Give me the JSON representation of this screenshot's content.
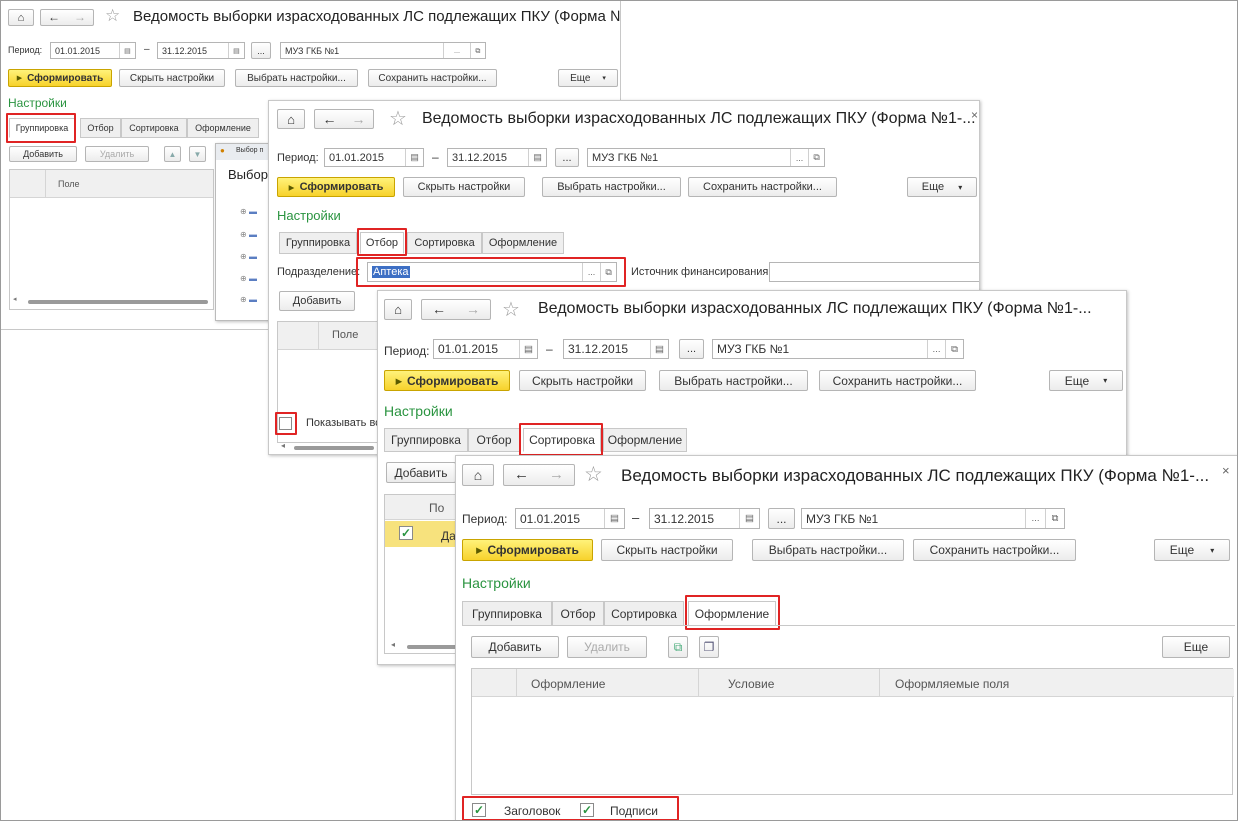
{
  "report": {
    "title": "Ведомость выборки израсходованных ЛС подлежащих ПКУ (Форма №1-...",
    "period_label": "Период:",
    "date_from": "01.01.2015",
    "date_to": "31.12.2015",
    "dash": "–",
    "dots": "...",
    "org": "МУЗ ГКБ №1",
    "generate": "Сформировать",
    "hide_settings": "Скрыть настройки",
    "choose_settings": "Выбрать настройки...",
    "save_settings": "Сохранить настройки...",
    "more": "Еще",
    "settings": "Настройки",
    "close": "×"
  },
  "tabs": {
    "grouping": "Группировка",
    "filter": "Отбор",
    "sorting": "Сортировка",
    "design": "Оформление"
  },
  "win1": {
    "add": "Добавить",
    "delete": "Удалить",
    "field_col": "Поле",
    "popup_title": "Выбор п",
    "popup_heading": "Выборк"
  },
  "win2": {
    "subdivision_label": "Подразделение:",
    "subdivision_value": "Аптека",
    "source_label": "Источник финансирования:",
    "add": "Добавить",
    "field_col": "Поле",
    "show_all": "Показывать вс"
  },
  "win3": {
    "add": "Добавить",
    "col_short": "По",
    "row_short": "Да"
  },
  "win4": {
    "add": "Добавить",
    "delete": "Удалить",
    "more": "Еще",
    "col_design": "Оформление",
    "col_condition": "Условие",
    "col_fields": "Оформляемые поля",
    "header_chk": "Заголовок",
    "signatures_chk": "Подписи"
  },
  "icons": {
    "home": "home-icon",
    "back": "arrow-left-icon",
    "forward": "arrow-right-icon",
    "favorite": "star-icon",
    "calendar": "calendar-icon",
    "open": "open-link-icon",
    "dropdown": "chevron-down-icon"
  },
  "colors": {
    "accent_green": "#2a9440",
    "highlight_red": "#e02424",
    "generate_yellow": "#f7d22c",
    "selection_blue": "#3d6fc4"
  }
}
